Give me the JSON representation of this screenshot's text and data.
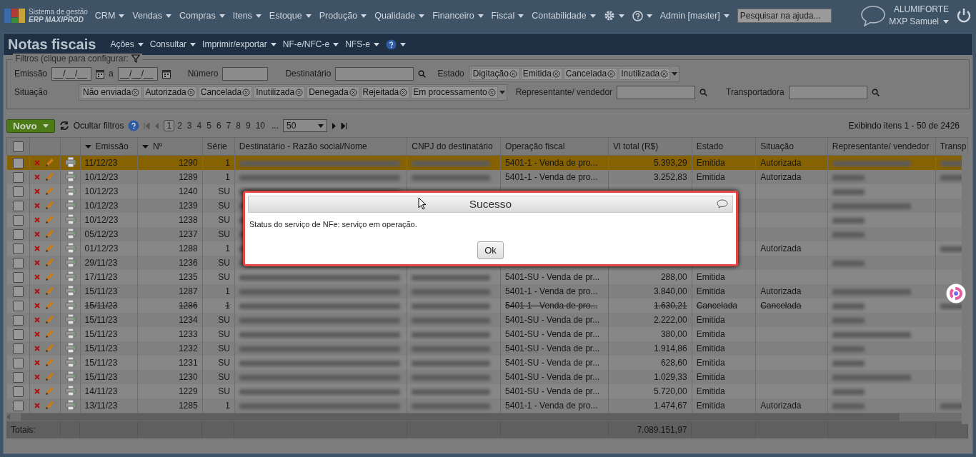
{
  "topbar": {
    "brand_line1": "Sistema de gestão",
    "brand_line2": "ERP MAXIPROD",
    "menus": [
      "CRM",
      "Vendas",
      "Compras",
      "Itens",
      "Estoque",
      "Produção",
      "Qualidade",
      "Financeiro",
      "Fiscal",
      "Contabilidade"
    ],
    "user_menu": "Admin [master]",
    "help_search": {
      "placeholder": "Pesquisar na ajuda..."
    },
    "company": "ALUMIFORTE",
    "user": "MXP Samuel"
  },
  "page": {
    "title": "Notas fiscais",
    "menus": [
      "Ações",
      "Consultar",
      "Imprimir/exportar",
      "NF-e/NFC-e",
      "NFS-e"
    ]
  },
  "filters": {
    "legend": "Filtros (clique para configurar:",
    "emissao_label": "Emissão",
    "date_from": {
      "value": "__/__/__"
    },
    "a_label": "a",
    "date_to": {
      "value": "__/__/__"
    },
    "numero_label": "Número",
    "destinatario_label": "Destinatário",
    "estado_label": "Estado",
    "estado_chips": [
      "Digitação",
      "Emitida",
      "Cancelada",
      "Inutilizada"
    ],
    "situacao_label": "Situação",
    "situacao_chips": [
      "Não enviada",
      "Autorizada",
      "Cancelada",
      "Inutilizada",
      "Denegada",
      "Rejeitada",
      "Em processamento"
    ],
    "representante_label": "Representante/ vendedor",
    "transportadora_label": "Transportadora"
  },
  "toolbar": {
    "new_button": "Novo",
    "hide_filters": "Ocultar filtros",
    "pages": [
      {
        "label": "1",
        "selected": true
      },
      {
        "label": "2",
        "selected": false
      },
      {
        "label": "3",
        "selected": false
      },
      {
        "label": "4",
        "selected": false
      },
      {
        "label": "5",
        "selected": false
      },
      {
        "label": "6",
        "selected": false
      },
      {
        "label": "7",
        "selected": false
      },
      {
        "label": "8",
        "selected": false
      },
      {
        "label": "9",
        "selected": false
      },
      {
        "label": "10",
        "selected": false
      }
    ],
    "ellipsis": "...",
    "page_size": "50",
    "summary": "Exibindo itens 1 - 50 de 2426"
  },
  "table": {
    "columns": [
      {
        "label": "Emissão",
        "sorted": true
      },
      {
        "label": "Nº",
        "sorted": true
      },
      {
        "label": "Série",
        "sorted": false
      },
      {
        "label": "Destinatário - Razão social/Nome",
        "sorted": false
      },
      {
        "label": "CNPJ do destinatário",
        "sorted": false
      },
      {
        "label": "Operação fiscal",
        "sorted": false
      },
      {
        "label": "Vl total (R$)",
        "sorted": false
      },
      {
        "label": "Estado",
        "sorted": false
      },
      {
        "label": "Situação",
        "sorted": false
      },
      {
        "label": "Representante/ vendedor",
        "sorted": false
      },
      {
        "label": "Transp",
        "sorted": false
      }
    ],
    "select_all_checked": false,
    "rows": [
      {
        "date": "11/12/23",
        "number": "1290",
        "series": "1",
        "operation": "5401-1 - Venda de pro...",
        "total": "5.393,29",
        "state": "Emitida",
        "situation": "Autorizada",
        "selected": true,
        "checked": false,
        "cancelled": false,
        "recipient_blurred": true,
        "cnpj_blurred": true,
        "rep_blurred": true,
        "carrier_blurred": true
      },
      {
        "date": "10/12/23",
        "number": "1289",
        "series": "1",
        "operation": "5401-1 - Venda de pro...",
        "total": "3.252,83",
        "state": "Emitida",
        "situation": "Autorizada",
        "selected": false,
        "checked": false,
        "cancelled": false,
        "recipient_blurred": true,
        "cnpj_blurred": true,
        "rep_blurred": true,
        "carrier_blurred": true
      },
      {
        "date": "10/12/23",
        "number": "1240",
        "series": "SU",
        "selected": false,
        "checked": false,
        "cancelled": false,
        "recipient_blurred": true,
        "cnpj_blurred": false,
        "rep_blurred": true,
        "carrier_blurred": false
      },
      {
        "date": "10/12/23",
        "number": "1239",
        "series": "SU",
        "selected": false,
        "checked": false,
        "cancelled": false,
        "recipient_blurred": true,
        "cnpj_blurred": false,
        "rep_blurred": true,
        "carrier_blurred": false
      },
      {
        "date": "10/12/23",
        "number": "1238",
        "series": "SU",
        "selected": false,
        "checked": false,
        "cancelled": false,
        "recipient_blurred": true,
        "cnpj_blurred": false,
        "rep_blurred": true,
        "carrier_blurred": false
      },
      {
        "date": "05/12/23",
        "number": "1237",
        "series": "SU",
        "selected": false,
        "checked": false,
        "cancelled": false,
        "recipient_blurred": true,
        "cnpj_blurred": false,
        "rep_blurred": true,
        "carrier_blurred": false
      },
      {
        "date": "01/12/23",
        "number": "1288",
        "series": "1",
        "situation": "Autorizada",
        "selected": false,
        "checked": false,
        "cancelled": false,
        "recipient_blurred": true,
        "cnpj_blurred": false,
        "rep_blurred": false,
        "carrier_blurred": true
      },
      {
        "date": "29/11/23",
        "number": "1236",
        "series": "SU",
        "selected": false,
        "checked": false,
        "cancelled": false,
        "recipient_blurred": true,
        "cnpj_blurred": false,
        "rep_blurred": true,
        "carrier_blurred": false
      },
      {
        "date": "17/11/23",
        "number": "1235",
        "series": "SU",
        "operation": "5401-SU - Venda de pr...",
        "total": "288,00",
        "state": "Emitida",
        "selected": false,
        "checked": false,
        "cancelled": false,
        "recipient_blurred": true,
        "cnpj_blurred": true,
        "rep_blurred": false,
        "carrier_blurred": false
      },
      {
        "date": "15/11/23",
        "number": "1287",
        "series": "1",
        "operation": "5401-1 - Venda de pro...",
        "total": "3.840,00",
        "state": "Emitida",
        "situation": "Autorizada",
        "selected": false,
        "checked": false,
        "cancelled": false,
        "recipient_blurred": true,
        "cnpj_blurred": true,
        "rep_blurred": true,
        "carrier_blurred": false
      },
      {
        "date": "15/11/23",
        "number": "1286",
        "series": "1",
        "operation": "5401-1 - Venda de pro...",
        "total": "1.630,21",
        "state": "Cancelada",
        "situation": "Cancelada",
        "selected": false,
        "checked": false,
        "cancelled": true,
        "recipient_blurred": true,
        "cnpj_blurred": true,
        "rep_blurred": true,
        "carrier_blurred": true
      },
      {
        "date": "15/11/23",
        "number": "1234",
        "series": "SU",
        "operation": "5401-SU - Venda de pr...",
        "total": "2.222,00",
        "state": "Emitida",
        "selected": false,
        "checked": false,
        "cancelled": false,
        "recipient_blurred": true,
        "cnpj_blurred": true,
        "rep_blurred": true,
        "carrier_blurred": false
      },
      {
        "date": "15/11/23",
        "number": "1233",
        "series": "SU",
        "operation": "5401-SU - Venda de pr...",
        "total": "380,00",
        "state": "Emitida",
        "selected": false,
        "checked": false,
        "cancelled": false,
        "recipient_blurred": true,
        "cnpj_blurred": true,
        "rep_blurred": true,
        "carrier_blurred": false
      },
      {
        "date": "15/11/23",
        "number": "1232",
        "series": "SU",
        "operation": "5401-SU - Venda de pr...",
        "total": "1.914,86",
        "state": "Emitida",
        "selected": false,
        "checked": false,
        "cancelled": false,
        "recipient_blurred": true,
        "cnpj_blurred": true,
        "rep_blurred": true,
        "carrier_blurred": false
      },
      {
        "date": "15/11/23",
        "number": "1231",
        "series": "SU",
        "operation": "5401-SU - Venda de pr...",
        "total": "628,60",
        "state": "Emitida",
        "selected": false,
        "checked": false,
        "cancelled": false,
        "recipient_blurred": true,
        "cnpj_blurred": true,
        "rep_blurred": true,
        "carrier_blurred": false
      },
      {
        "date": "15/11/23",
        "number": "1230",
        "series": "SU",
        "operation": "5401-SU - Venda de pr...",
        "total": "1.029,33",
        "state": "Emitida",
        "selected": false,
        "checked": false,
        "cancelled": false,
        "recipient_blurred": true,
        "cnpj_blurred": true,
        "rep_blurred": true,
        "carrier_blurred": false
      },
      {
        "date": "14/11/23",
        "number": "1229",
        "series": "SU",
        "operation": "5401-SU - Venda de pr...",
        "total": "5.720,00",
        "state": "Emitida",
        "selected": false,
        "checked": false,
        "cancelled": false,
        "recipient_blurred": true,
        "cnpj_blurred": true,
        "rep_blurred": true,
        "carrier_blurred": false
      },
      {
        "date": "13/11/23",
        "number": "1285",
        "series": "1",
        "operation": "5401-1 - Venda de pro...",
        "total": "1.474,67",
        "state": "Emitida",
        "situation": "Autorizada",
        "selected": false,
        "checked": false,
        "cancelled": false,
        "recipient_blurred": true,
        "cnpj_blurred": true,
        "rep_blurred": true,
        "carrier_blurred": true
      }
    ],
    "totals_label": "Totais:",
    "total_value": "7.089.151,97"
  },
  "dialog": {
    "title": "Sucesso",
    "message": "Status do serviço de NFe: serviço em operação.",
    "button": "Ok"
  }
}
